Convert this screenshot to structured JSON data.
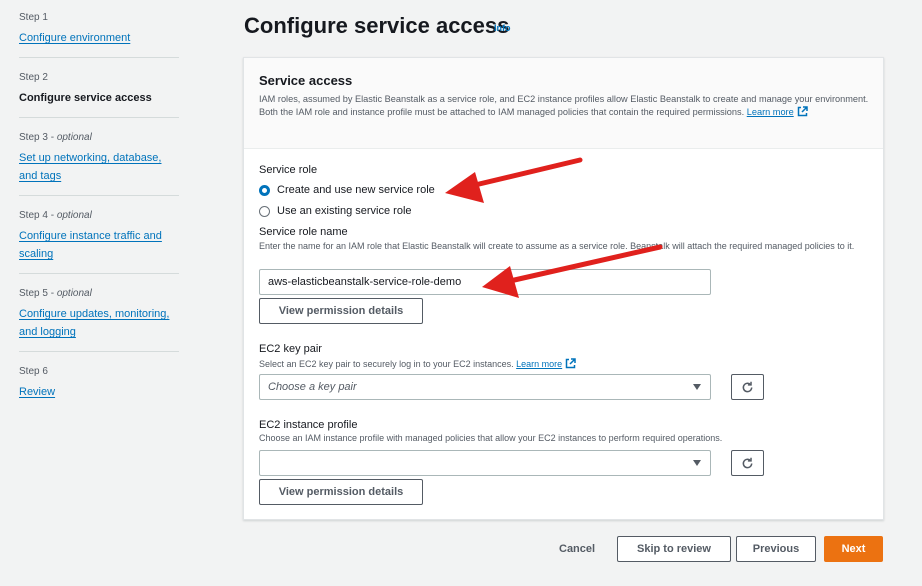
{
  "sidebar": {
    "steps": [
      {
        "label": "Step 1",
        "optional": "",
        "title": "Configure environment"
      },
      {
        "label": "Step 2",
        "optional": "",
        "title": "Configure service access"
      },
      {
        "label": "Step 3 - ",
        "optional": "optional",
        "title_line1": "Set up networking, database,",
        "title_line2": "and tags"
      },
      {
        "label": "Step 4 - ",
        "optional": "optional",
        "title_line1": "Configure instance traffic and",
        "title_line2": "scaling"
      },
      {
        "label": "Step 5 - ",
        "optional": "optional",
        "title_line1": "Configure updates, monitoring,",
        "title_line2": "and logging"
      },
      {
        "label": "Step 6",
        "optional": "",
        "title": "Review"
      }
    ]
  },
  "page": {
    "title": "Configure service access",
    "info": "Info"
  },
  "panel": {
    "title": "Service access",
    "description": "IAM roles, assumed by Elastic Beanstalk as a service role, and EC2 instance profiles allow Elastic Beanstalk to create and manage your environment. Both the IAM role and instance profile must be attached to IAM managed policies that contain the required permissions.",
    "learn_more": "Learn more"
  },
  "service_role": {
    "label": "Service role",
    "options": [
      "Create and use new service role",
      "Use an existing service role"
    ],
    "selected": 0,
    "name_label": "Service role name",
    "name_description": "Enter the name for an IAM role that Elastic Beanstalk will create to assume as a service role. Beanstalk will attach the required managed policies to it.",
    "name_value": "aws-elasticbeanstalk-service-role-demo",
    "view_permissions": "View permission details"
  },
  "key_pair": {
    "label": "EC2 key pair",
    "description": "Select an EC2 key pair to securely log in to your EC2 instances.",
    "learn_more": "Learn more",
    "placeholder": "Choose a key pair"
  },
  "instance_profile": {
    "label": "EC2 instance profile",
    "description": "Choose an IAM instance profile with managed policies that allow your EC2 instances to perform required operations.",
    "value": "",
    "view_permissions": "View permission details"
  },
  "footer": {
    "cancel": "Cancel",
    "skip": "Skip to review",
    "previous": "Previous",
    "next": "Next"
  },
  "colors": {
    "accent": "#0073bb",
    "primary": "#ec7211",
    "annotation": "#e0211d"
  }
}
